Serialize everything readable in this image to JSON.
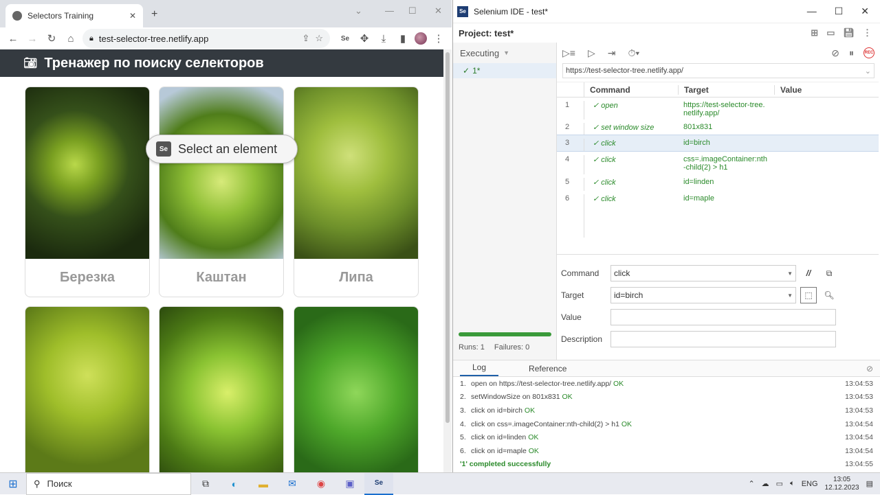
{
  "browser": {
    "tab_title": "Selectors Training",
    "url": "test-selector-tree.netlify.app",
    "page_header": "Тренажер по поиску селекторов",
    "cards": [
      {
        "label": "Березка"
      },
      {
        "label": "Каштан"
      },
      {
        "label": "Липа"
      },
      {
        "label": ""
      },
      {
        "label": ""
      },
      {
        "label": ""
      }
    ],
    "select_overlay": "Select an element"
  },
  "ide": {
    "window_title": "Selenium IDE - test*",
    "project_label": "Project:",
    "project_name": "test*",
    "executing_label": "Executing",
    "suite_test": "1*",
    "base_url": "https://test-selector-tree.netlify.app/",
    "columns": {
      "command": "Command",
      "target": "Target",
      "value": "Value"
    },
    "commands": [
      {
        "n": "1",
        "command": "open",
        "target": "https://test-selector-tree.netlify.app/",
        "value": ""
      },
      {
        "n": "2",
        "command": "set window size",
        "target": "801x831",
        "value": ""
      },
      {
        "n": "3",
        "command": "click",
        "target": "id=birch",
        "value": ""
      },
      {
        "n": "4",
        "command": "click",
        "target": "css=.imageContainer:nth-child(2) > h1",
        "value": ""
      },
      {
        "n": "5",
        "command": "click",
        "target": "id=linden",
        "value": ""
      },
      {
        "n": "6",
        "command": "click",
        "target": "id=maple",
        "value": ""
      }
    ],
    "editor": {
      "command_label": "Command",
      "command_value": "click",
      "target_label": "Target",
      "target_value": "id=birch",
      "value_label": "Value",
      "description_label": "Description",
      "comment_toggle": "//"
    },
    "runs": {
      "runs": "Runs: 1",
      "failures": "Failures: 0",
      "progress": 1.0
    },
    "log_tabs": [
      "Log",
      "Reference"
    ],
    "log": [
      {
        "n": "1.",
        "text": "open on https://test-selector-tree.netlify.app/",
        "status": "OK",
        "time": "13:04:53"
      },
      {
        "n": "2.",
        "text": "setWindowSize on 801x831",
        "status": "OK",
        "time": "13:04:53"
      },
      {
        "n": "3.",
        "text": "click on id=birch",
        "status": "OK",
        "time": "13:04:53"
      },
      {
        "n": "4.",
        "text": "click on css=.imageContainer:nth-child(2) > h1",
        "status": "OK",
        "time": "13:04:54"
      },
      {
        "n": "5.",
        "text": "click on id=linden",
        "status": "OK",
        "time": "13:04:54"
      },
      {
        "n": "6.",
        "text": "click on id=maple",
        "status": "OK",
        "time": "13:04:54"
      }
    ],
    "log_done": {
      "text": "'1' completed successfully",
      "time": "13:04:55"
    }
  },
  "taskbar": {
    "search_placeholder": "Поиск",
    "lang": "ENG",
    "time": "13:05",
    "date": "12.12.2023"
  },
  "colors": {
    "accent": "#1e5fa8",
    "ok": "#2a8a2a",
    "header": "#343a40"
  }
}
